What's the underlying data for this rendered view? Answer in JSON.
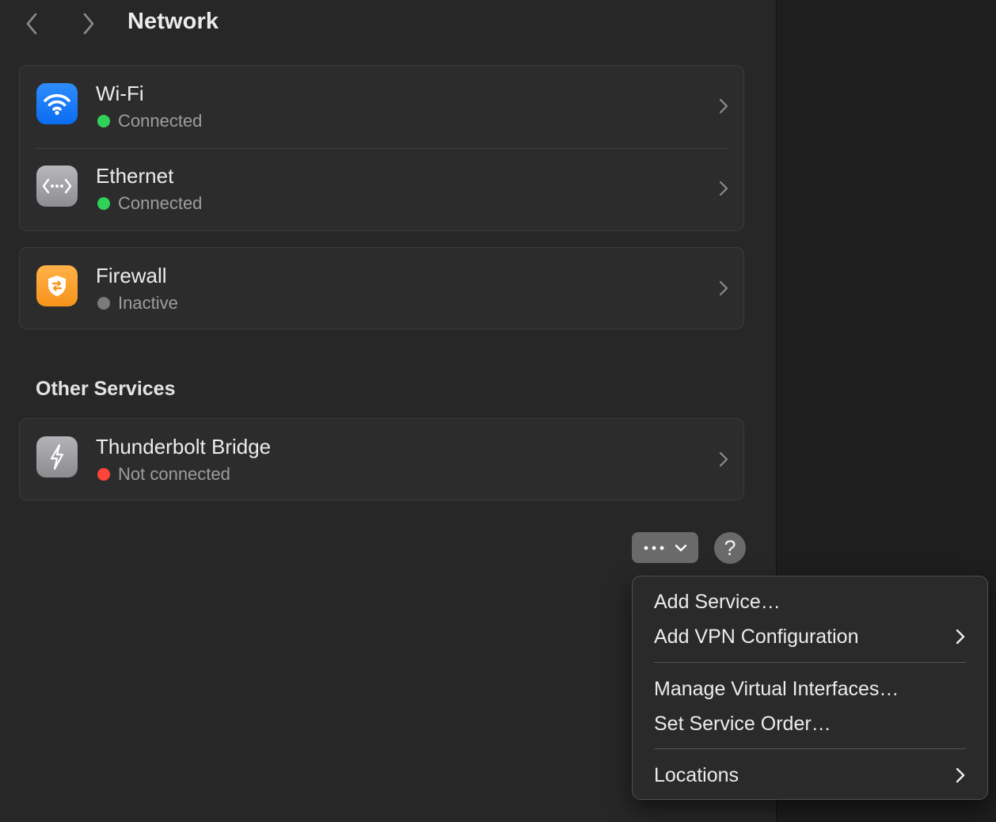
{
  "toolbar": {
    "back_icon": "chevron-left-icon",
    "forward_icon": "chevron-right-icon",
    "title": "Network"
  },
  "services": [
    {
      "name": "Wi-Fi",
      "status": "Connected",
      "status_color": "#30d158",
      "icon": "wifi-icon"
    },
    {
      "name": "Ethernet",
      "status": "Connected",
      "status_color": "#30d158",
      "icon": "ethernet-icon"
    }
  ],
  "firewall": {
    "name": "Firewall",
    "status": "Inactive",
    "status_color": "#7a7a7a",
    "icon": "firewall-shield-icon"
  },
  "other_services": {
    "title": "Other Services",
    "items": [
      {
        "name": "Thunderbolt Bridge",
        "status": "Not connected",
        "status_color": "#ff453a",
        "icon": "thunderbolt-icon"
      }
    ]
  },
  "actions": {
    "more_icon": "ellipsis-icon",
    "dropdown_icon": "chevron-down-icon",
    "help_label": "?"
  },
  "menu": {
    "items": [
      {
        "label": "Add Service…",
        "submenu": false
      },
      {
        "label": "Add VPN Configuration",
        "submenu": true
      },
      {
        "label": "Manage Virtual Interfaces…",
        "submenu": false
      },
      {
        "label": "Set Service Order…",
        "submenu": false
      },
      {
        "label": "Locations",
        "submenu": true
      }
    ]
  },
  "colors": {
    "wifi_accent": "#0a84ff",
    "firewall_accent": "#ff9f0a",
    "connected": "#30d158",
    "not_connected": "#ff453a",
    "inactive": "#7a7a7a"
  }
}
